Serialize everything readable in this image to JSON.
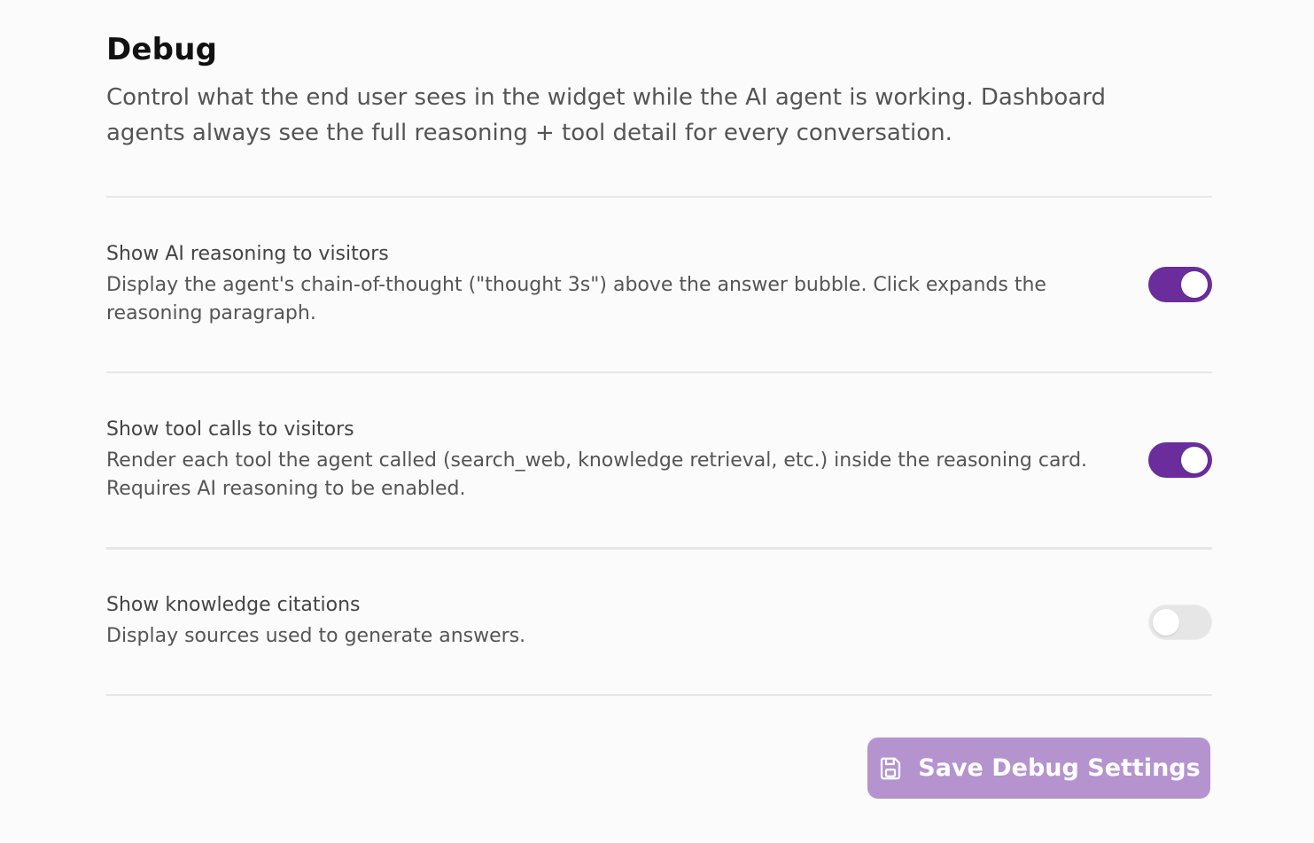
{
  "header": {
    "title": "Debug",
    "description": "Control what the end user sees in the widget while the AI agent is working. Dashboard agents always see the full reasoning + tool detail for every conversation."
  },
  "settings": [
    {
      "title": "Show AI reasoning to visitors",
      "description": "Display the agent's chain-of-thought (\"thought 3s\") above the answer bubble. Click expands the reasoning paragraph.",
      "enabled": true
    },
    {
      "title": "Show tool calls to visitors",
      "description": "Render each tool the agent called (search_web, knowledge retrieval, etc.) inside the reasoning card. Requires AI reasoning to be enabled.",
      "enabled": true
    },
    {
      "title": "Show knowledge citations",
      "description": "Display sources used to generate answers.",
      "enabled": false
    }
  ],
  "footer": {
    "save_label": "Save Debug Settings",
    "save_icon": "save-icon"
  },
  "colors": {
    "accent": "#6a2d9b",
    "accent_muted": "#b493cf",
    "toggle_off": "#e6e6e6"
  }
}
